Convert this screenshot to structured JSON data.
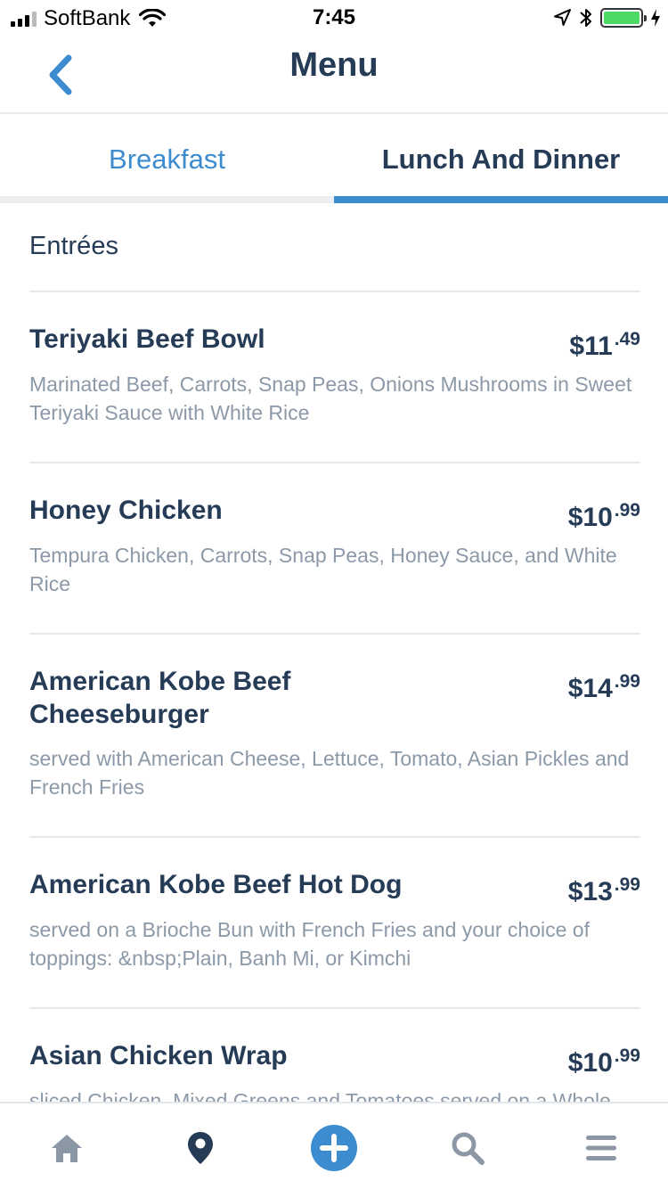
{
  "status_bar": {
    "carrier": "SoftBank",
    "time": "7:45"
  },
  "header": {
    "title": "Menu",
    "back_icon": "chevron-left-icon"
  },
  "tabs": [
    {
      "label": "Breakfast",
      "active": false
    },
    {
      "label": "Lunch And Dinner",
      "active": true
    }
  ],
  "section": {
    "heading": "Entrées"
  },
  "items": [
    {
      "name": "Teriyaki Beef Bowl",
      "price_dollars": "$11",
      "price_cents": ".49",
      "description": "Marinated Beef, Carrots, Snap Peas, Onions Mushrooms in Sweet Teriyaki Sauce with White Rice"
    },
    {
      "name": "Honey Chicken",
      "price_dollars": "$10",
      "price_cents": ".99",
      "description": "Tempura Chicken, Carrots, Snap Peas, Honey Sauce, and White Rice"
    },
    {
      "name": "American Kobe Beef Cheeseburger",
      "price_dollars": "$14",
      "price_cents": ".99",
      "description": "served with American Cheese, Lettuce, Tomato, Asian Pickles and French Fries"
    },
    {
      "name": "American Kobe Beef Hot Dog",
      "price_dollars": "$13",
      "price_cents": ".99",
      "description": "served on a Brioche Bun with French Fries and your choice of toppings: &nbsp;Plain, Banh Mi, or Kimchi"
    },
    {
      "name": "Asian Chicken Wrap",
      "price_dollars": "$10",
      "price_cents": ".99",
      "description": "sliced Chicken, Mixed Greens and Tomatoes served on a Whole"
    }
  ],
  "bottom_nav": [
    {
      "icon": "home-icon"
    },
    {
      "icon": "map-pin-icon"
    },
    {
      "icon": "plus-circle-icon"
    },
    {
      "icon": "search-icon"
    },
    {
      "icon": "hamburger-menu-icon"
    }
  ],
  "colors": {
    "accent": "#3d8ccf",
    "text_dark": "#253b56",
    "text_muted": "#8c99a8",
    "battery": "#4cd964"
  }
}
